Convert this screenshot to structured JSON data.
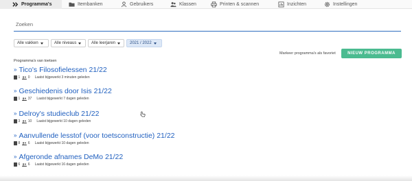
{
  "nav": {
    "tabs": [
      {
        "label": "Programma's",
        "icon": "chevrons-icon",
        "active": true
      },
      {
        "label": "Itembanken",
        "icon": "folder-icon"
      },
      {
        "label": "Gebruikers",
        "icon": "user-icon"
      },
      {
        "label": "Klassen",
        "icon": "users-icon"
      },
      {
        "label": "Printen & scannen",
        "icon": "printer-icon"
      },
      {
        "label": "Inzichten",
        "icon": "chart-icon"
      },
      {
        "label": "Instellingen",
        "icon": "gear-icon"
      }
    ]
  },
  "search": {
    "placeholder": "Zoeken",
    "value": ""
  },
  "filters": [
    {
      "label": "Alle vakken"
    },
    {
      "label": "Alle niveaus"
    },
    {
      "label": "Alle leerjaren"
    },
    {
      "label": "2021 / 2022",
      "selected": true
    }
  ],
  "favorite_hint": "Markeer programma's als favoriet",
  "new_program_label": "NIEUW PROGRAMMA",
  "section_title": "Programma's van toetsen",
  "programs": [
    {
      "title": "Tico's Filosofielessen 21/22",
      "docs": "1",
      "students": "0",
      "updated": "Laatst bijgewerkt 3 minuten geleden"
    },
    {
      "title": "Geschiedenis door Isis 21/22",
      "docs": "1",
      "students": "37",
      "updated": "Laatst bijgewerkt 7 dagen geleden"
    },
    {
      "title": "Delroy's studieclub 21/22",
      "docs": "3",
      "students": "10",
      "updated": "Laatst bijgewerkt 10 dagen geleden"
    },
    {
      "title": "Aanvullende lesstof (voor toetsconstructie) 21/22",
      "docs": "8",
      "students": "6",
      "updated": "Laatst bijgewerkt 10 dagen geleden"
    },
    {
      "title": "Afgeronde afnames DeMo 21/22",
      "docs": "6",
      "students": "6",
      "updated": "Laatst bijgewerkt 16 dagen geleden"
    }
  ],
  "colors": {
    "accent": "#1f5fbf",
    "button": "#4bbb90",
    "search_underline": "#2e6dbf"
  }
}
